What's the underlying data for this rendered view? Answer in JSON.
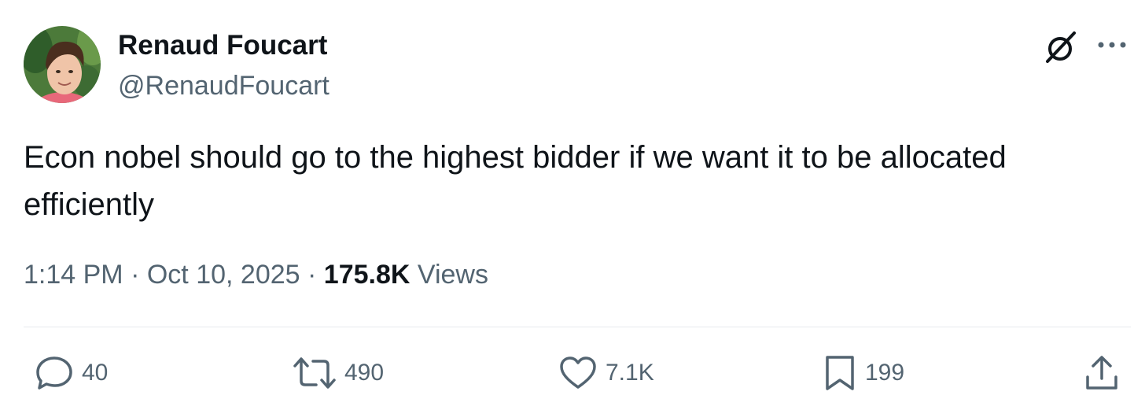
{
  "author": {
    "name": "Renaud Foucart",
    "handle": "@RenaudFoucart"
  },
  "tweet": {
    "text": "Econ nobel should go to the highest bidder if we want it to be allocated efficiently",
    "time": "1:14 PM",
    "date": "Oct 10, 2025",
    "views_count": "175.8K",
    "views_label": "Views"
  },
  "actions": {
    "replies": "40",
    "reposts": "490",
    "likes": "7.1K",
    "bookmarks": "199"
  },
  "icons": {
    "header": [
      "grok-icon",
      "more-options-icon"
    ],
    "actions": [
      "reply-icon",
      "repost-icon",
      "like-icon",
      "bookmark-icon",
      "share-icon"
    ]
  },
  "colors": {
    "text_primary": "#0f1419",
    "text_secondary": "#536471",
    "divider": "#e6eaed"
  }
}
